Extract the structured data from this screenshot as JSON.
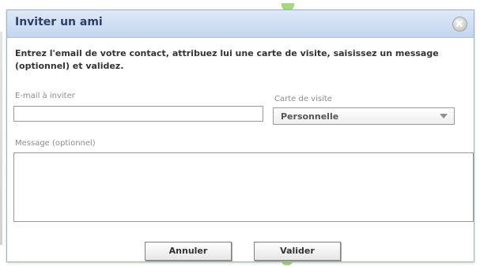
{
  "dialog": {
    "title": "Inviter un ami",
    "intro": "Entrez l'email de votre contact, attribuez lui une carte de visite, saisissez un message (optionnel) et validez."
  },
  "form": {
    "email_label": "E-mail à inviter",
    "email_value": "",
    "card_label": "Carte de visite",
    "card_selected": "Personnelle",
    "message_label": "Message (optionnel)",
    "message_value": ""
  },
  "buttons": {
    "cancel_label": "Annuler",
    "validate_label": "Valider"
  },
  "icons": {
    "close": "close-icon",
    "dropdown": "chevron-down-icon"
  },
  "colors": {
    "titlebar_top": "#dde9f8",
    "titlebar_bottom": "#c3d6ef",
    "title_text": "#2c3f66",
    "label_text": "#8c8c8c",
    "body_text": "#333333"
  }
}
